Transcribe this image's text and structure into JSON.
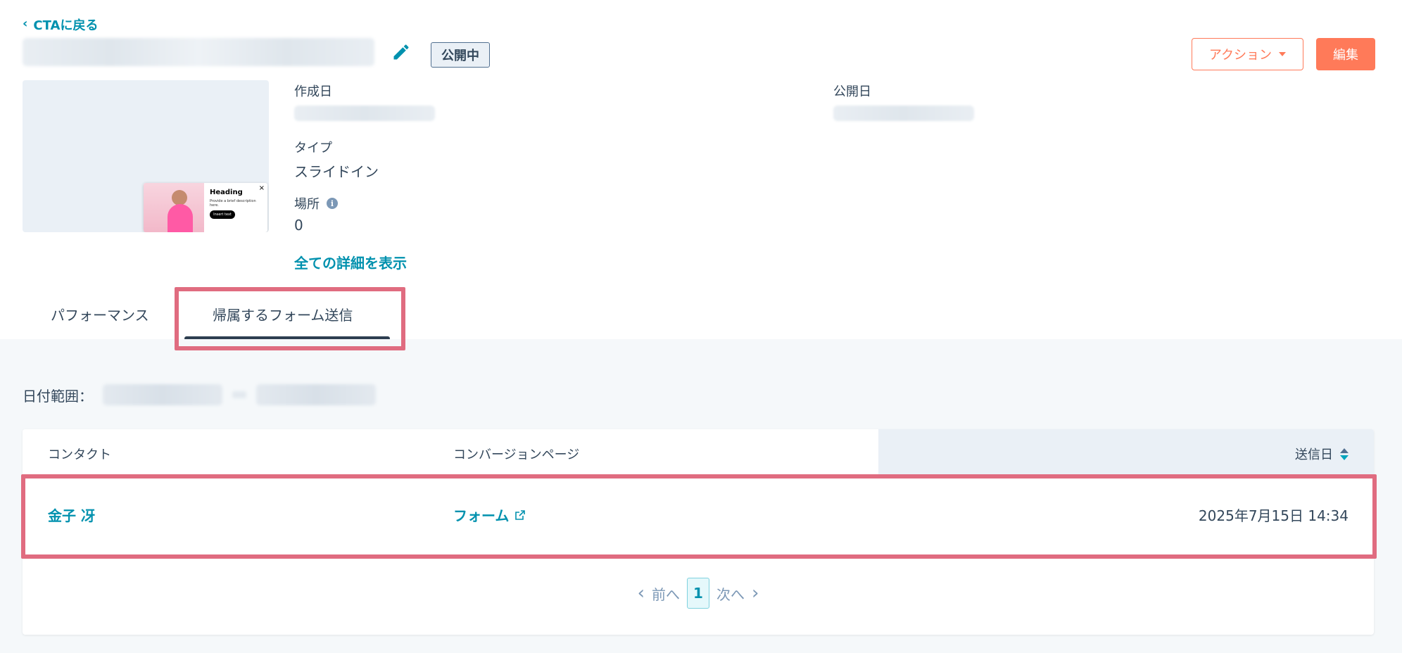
{
  "header": {
    "back_label": "CTAに戻る",
    "status_label": "公開中",
    "actions_label": "アクション",
    "edit_label": "編集"
  },
  "thumbnail": {
    "heading": "Heading",
    "description": "Provide a brief description here.",
    "button_text": "Insert text"
  },
  "meta": {
    "created_label": "作成日",
    "published_label": "公開日",
    "type_label": "タイプ",
    "type_value": "スライドイン",
    "location_label": "場所",
    "location_value": "0",
    "details_link": "全ての詳細を表示"
  },
  "tabs": [
    {
      "label": "パフォーマンス",
      "active": false
    },
    {
      "label": "帰属するフォーム送信",
      "active": true
    }
  ],
  "filters": {
    "date_range_label": "日付範囲："
  },
  "table": {
    "columns": [
      "コンタクト",
      "コンバージョンページ",
      "送信日"
    ],
    "rows": [
      {
        "contact": "金子 冴",
        "page": "フォーム",
        "date": "2025年7月15日 14:34"
      }
    ]
  },
  "pagination": {
    "prev_label": "前へ",
    "current": "1",
    "next_label": "次へ"
  },
  "colors": {
    "accent_link": "#0091ae",
    "primary_button": "#ff7a59",
    "highlight_border": "#e06c80",
    "background_lower": "#f5f8fa"
  }
}
